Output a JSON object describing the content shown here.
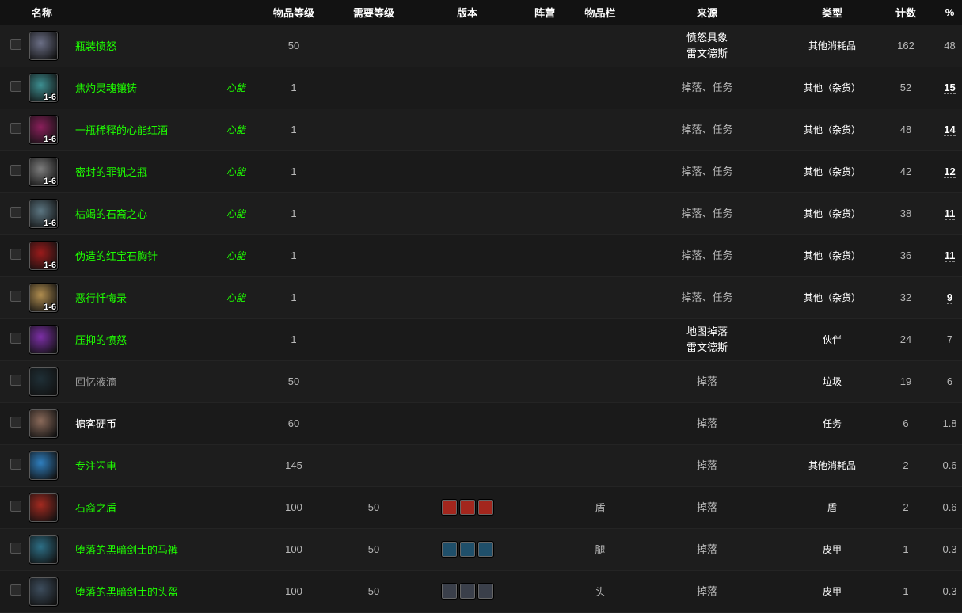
{
  "headers": {
    "name": "名称",
    "item_level": "物品等级",
    "req_level": "需要等级",
    "version": "版本",
    "faction": "阵营",
    "slot": "物品栏",
    "source": "来源",
    "type": "类型",
    "count": "计数",
    "percent": "%"
  },
  "rows": [
    {
      "name": "瓶装愤怒",
      "quality": "green",
      "stack": "",
      "tag": "",
      "ilvl": "50",
      "req": "",
      "slot": "",
      "source1": "愤怒具象",
      "source2": "雷文德斯",
      "type": "其他消耗品",
      "count": "162",
      "pct": "48",
      "pct_u": false,
      "icon_color": "#6b6f86",
      "icon": "bottle-icon"
    },
    {
      "name": "焦灼灵魂镶铸",
      "quality": "green",
      "stack": "1-6",
      "tag": "心能",
      "ilvl": "1",
      "req": "",
      "slot": "",
      "source1": "掉落、任务",
      "source2": "",
      "type": "其他（杂货）",
      "count": "52",
      "pct": "15",
      "pct_u": true,
      "icon_color": "#3d8f91",
      "icon": "soul-cast-icon"
    },
    {
      "name": "一瓶稀释的心能红酒",
      "quality": "green",
      "stack": "1-6",
      "tag": "心能",
      "ilvl": "1",
      "req": "",
      "slot": "",
      "source1": "掉落、任务",
      "source2": "",
      "type": "其他（杂货）",
      "count": "48",
      "pct": "14",
      "pct_u": true,
      "icon_color": "#8a1f5b",
      "icon": "wine-bottle-icon"
    },
    {
      "name": "密封的罪钒之瓶",
      "quality": "green",
      "stack": "1-6",
      "tag": "心能",
      "ilvl": "1",
      "req": "",
      "slot": "",
      "source1": "掉落、任务",
      "source2": "",
      "type": "其他（杂货）",
      "count": "42",
      "pct": "12",
      "pct_u": true,
      "icon_color": "#7d7d7d",
      "icon": "sealed-flask-icon"
    },
    {
      "name": "枯竭的石裔之心",
      "quality": "green",
      "stack": "1-6",
      "tag": "心能",
      "ilvl": "1",
      "req": "",
      "slot": "",
      "source1": "掉落、任务",
      "source2": "",
      "type": "其他（杂货）",
      "count": "38",
      "pct": "11",
      "pct_u": true,
      "icon_color": "#5c7682",
      "icon": "stone-heart-icon"
    },
    {
      "name": "伪造的红宝石胸针",
      "quality": "green",
      "stack": "1-6",
      "tag": "心能",
      "ilvl": "1",
      "req": "",
      "slot": "",
      "source1": "掉落、任务",
      "source2": "",
      "type": "其他（杂货）",
      "count": "36",
      "pct": "11",
      "pct_u": true,
      "icon_color": "#9b1b1b",
      "icon": "ruby-brooch-icon"
    },
    {
      "name": "恶行忏悔录",
      "quality": "green",
      "stack": "1-6",
      "tag": "心能",
      "ilvl": "1",
      "req": "",
      "slot": "",
      "source1": "掉落、任务",
      "source2": "",
      "type": "其他（杂货）",
      "count": "32",
      "pct": "9",
      "pct_u": true,
      "icon_color": "#b08d4f",
      "icon": "scroll-icon"
    },
    {
      "name": "压抑的愤怒",
      "quality": "green",
      "stack": "",
      "tag": "",
      "ilvl": "1",
      "req": "",
      "slot": "",
      "source1": "地图掉落",
      "source2": "雷文德斯",
      "type": "伙伴",
      "count": "24",
      "pct": "7",
      "pct_u": false,
      "icon_color": "#7c2fa6",
      "icon": "purple-potion-icon"
    },
    {
      "name": "回忆液滴",
      "quality": "poor",
      "stack": "",
      "tag": "",
      "ilvl": "50",
      "req": "",
      "slot": "",
      "source1": "掉落",
      "source2": "",
      "type": "垃圾",
      "count": "19",
      "pct": "6",
      "pct_u": false,
      "icon_color": "#1f2f36",
      "icon": "droplet-icon"
    },
    {
      "name": "掮客硬币",
      "quality": "common",
      "stack": "",
      "tag": "",
      "ilvl": "60",
      "req": "",
      "slot": "",
      "source1": "掉落",
      "source2": "",
      "type": "任务",
      "count": "6",
      "pct": "1.8",
      "pct_u": false,
      "icon_color": "#8a6a5a",
      "icon": "coin-icon"
    },
    {
      "name": "专注闪电",
      "quality": "green",
      "stack": "",
      "tag": "",
      "ilvl": "145",
      "req": "",
      "slot": "",
      "source1": "掉落",
      "source2": "",
      "type": "其他消耗品",
      "count": "2",
      "pct": "0.6",
      "pct_u": false,
      "icon_color": "#2f7fbf",
      "icon": "lightning-icon"
    },
    {
      "name": "石裔之盾",
      "quality": "green",
      "stack": "",
      "tag": "",
      "ilvl": "100",
      "req": "50",
      "slot": "盾",
      "source1": "掉落",
      "source2": "",
      "type": "盾",
      "count": "2",
      "pct": "0.6",
      "pct_u": false,
      "icon_color": "#a32a20",
      "icon": "shield-icon",
      "mini_color": "#a3261d"
    },
    {
      "name": "堕落的黑暗剑士的马裤",
      "quality": "green",
      "stack": "",
      "tag": "",
      "ilvl": "100",
      "req": "50",
      "slot": "腿",
      "source1": "掉落",
      "source2": "",
      "type": "皮甲",
      "count": "1",
      "pct": "0.3",
      "pct_u": false,
      "icon_color": "#2d6f86",
      "icon": "pants-icon",
      "mini_color": "#1f4f6a"
    },
    {
      "name": "堕落的黑暗剑士的头盔",
      "quality": "green",
      "stack": "",
      "tag": "",
      "ilvl": "100",
      "req": "50",
      "slot": "头",
      "source1": "掉落",
      "source2": "",
      "type": "皮甲",
      "count": "1",
      "pct": "0.3",
      "pct_u": false,
      "icon_color": "#3d4d5d",
      "icon": "helm-icon",
      "mini_color": "#3a3f4a"
    }
  ]
}
